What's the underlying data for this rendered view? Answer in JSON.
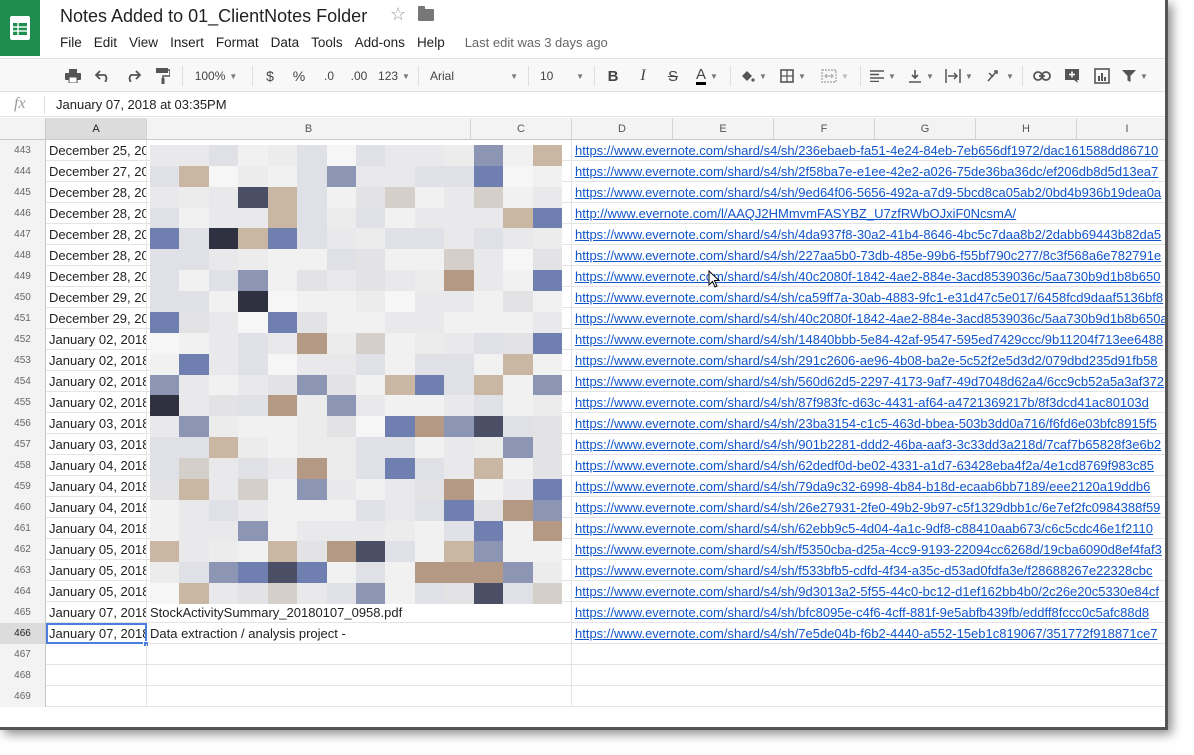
{
  "title": "Notes Added to 01_ClientNotes Folder",
  "menu": [
    "File",
    "Edit",
    "View",
    "Insert",
    "Format",
    "Data",
    "Tools",
    "Add-ons",
    "Help"
  ],
  "last_edit": "Last edit was 3 days ago",
  "toolbar": {
    "zoom": "100%",
    "currency": "$",
    "percent": "%",
    "dec_less": ".0",
    "dec_more": ".00",
    "more_formats": "123",
    "font": "Arial",
    "font_size": "10",
    "bold": "B",
    "italic": "I",
    "strike": "S",
    "text_color": "A"
  },
  "formula_bar": {
    "fx": "fx",
    "value": "January 07, 2018 at 03:35PM"
  },
  "columns": [
    "A",
    "B",
    "C",
    "D",
    "E",
    "F",
    "G",
    "H",
    "I"
  ],
  "rows": [
    {
      "n": "443",
      "a": "December 25, 20",
      "c": "",
      "d": "https://www.evernote.com/shard/s4/sh/236ebaeb-fa51-4e24-84eb-7eb656df1972/dac161588dd86710"
    },
    {
      "n": "444",
      "a": "December 27, 20",
      "c": "",
      "d": "https://www.evernote.com/shard/s4/sh/2f58ba7e-e1ee-42e2-a026-75de36ba36dc/ef206db8d5d13ea7"
    },
    {
      "n": "445",
      "a": "December 28, 20",
      "c": "",
      "d": "https://www.evernote.com/shard/s4/sh/9ed64f06-5656-492a-a7d9-5bcd8ca05ab2/0bd4b936b19dea0a"
    },
    {
      "n": "446",
      "a": "December 28, 20",
      "c": "",
      "d": "http://www.evernote.com/l/AAQJ2HMmvmFASYBZ_U7zfRWbOJxiF0NcsmA/"
    },
    {
      "n": "447",
      "a": "December 28, 20",
      "c": "",
      "d": "https://www.evernote.com/shard/s4/sh/4da937f8-30a2-41b4-8646-4bc5c7daa8b2/2dabb69443b82da5"
    },
    {
      "n": "448",
      "a": "December 28, 20",
      "c": "",
      "d": "https://www.evernote.com/shard/s4/sh/227aa5b0-73db-485e-99b6-f55bf790c277/8c3f568a6e782791e"
    },
    {
      "n": "449",
      "a": "December 28, 20",
      "c": "",
      "d": "https://www.evernote.com/shard/s4/sh/40c2080f-1842-4ae2-884e-3acd8539036c/5aa730b9d1b8b650"
    },
    {
      "n": "450",
      "a": "December 29, 20",
      "c": "",
      "d": "https://www.evernote.com/shard/s4/sh/ca59ff7a-30ab-4883-9fc1-e31d47c5e017/6458fcd9daaf5136bf8"
    },
    {
      "n": "451",
      "a": "December 29, 20",
      "c": "",
      "d": "https://www.evernote.com/shard/s4/sh/40c2080f-1842-4ae2-884e-3acd8539036c/5aa730b9d1b8b650a"
    },
    {
      "n": "452",
      "a": "January 02, 2018",
      "c": "",
      "d": "https://www.evernote.com/shard/s4/sh/14840bbb-5e84-42af-9547-595ed7429ccc/9b11204f713ee6488"
    },
    {
      "n": "453",
      "a": "January 02, 2018",
      "c": "",
      "d": "https://www.evernote.com/shard/s4/sh/291c2606-ae96-4b08-ba2e-5c52f2e5d3d2/079dbd235d91fb58"
    },
    {
      "n": "454",
      "a": "January 02, 2018",
      "c": "",
      "d": "https://www.evernote.com/shard/s4/sh/560d62d5-2297-4173-9af7-49d7048d62a4/6cc9cb52a5a3af372"
    },
    {
      "n": "455",
      "a": "January 02, 2018",
      "c": "",
      "d": "https://www.evernote.com/shard/s4/sh/87f983fc-d63c-4431-af64-a4721369217b/8f3dcd41ac80103d"
    },
    {
      "n": "456",
      "a": "January 03, 2018",
      "c": "",
      "d": "https://www.evernote.com/shard/s4/sh/23ba3154-c1c5-463d-bbea-503b3dd0a716/f6fd6e03bfc8915f5"
    },
    {
      "n": "457",
      "a": "January 03, 2018",
      "c": "",
      "d": "https://www.evernote.com/shard/s4/sh/901b2281-ddd2-46ba-aaf3-3c33dd3a218d/7caf7b65828f3e6b2"
    },
    {
      "n": "458",
      "a": "January 04, 2018",
      "c": "",
      "d": "https://www.evernote.com/shard/s4/sh/62dedf0d-be02-4331-a1d7-63428eba4f2a/4e1cd8769f983c85"
    },
    {
      "n": "459",
      "a": "January 04, 2018",
      "c": "",
      "d": "https://www.evernote.com/shard/s4/sh/79da9c32-6998-4b84-b18d-ecaab6bb7189/eee2120a19ddb6"
    },
    {
      "n": "460",
      "a": "January 04, 2018",
      "c": "",
      "d": "https://www.evernote.com/shard/s4/sh/26e27931-2fe0-49b2-9b97-c5f1329dbb1c/6e7ef2fc0984388f59"
    },
    {
      "n": "461",
      "a": "January 04, 2018",
      "c": "",
      "d": "https://www.evernote.com/shard/s4/sh/62ebb9c5-4d04-4a1c-9df8-c88410aab673/c6c5cdc46e1f2110"
    },
    {
      "n": "462",
      "a": "January 05, 2018",
      "c": "",
      "d": "https://www.evernote.com/shard/s4/sh/f5350cba-d25a-4cc9-9193-22094cc6268d/19cba6090d8ef4faf3"
    },
    {
      "n": "463",
      "a": "January 05, 2018",
      "c": "",
      "d": "https://www.evernote.com/shard/s4/sh/f533bfb5-cdfd-4f34-a35c-d53ad0fdfa3e/f28688267e22328cbc"
    },
    {
      "n": "464",
      "a": "January 05, 2018",
      "c": "",
      "d": "https://www.evernote.com/shard/s4/sh/9d3013a2-5f55-44c0-bc12-d1ef162bb4b0/2c26e20c5330e84cf"
    },
    {
      "n": "465",
      "a": "January 07, 2018",
      "b": "StockActivitySummary_20180107_0958.pdf",
      "d": "https://www.evernote.com/shard/s4/sh/bfc8095e-c4f6-4cff-881f-9e5abfb439fb/eddff8fccc0c5afc88d8"
    },
    {
      "n": "466",
      "a": "January 07, 2018",
      "b": "Data extraction / analysis project -",
      "d": "https://www.evernote.com/shard/s4/sh/7e5de04b-f6b2-4440-a552-15eb1c819067/351772f918871ce7"
    },
    {
      "n": "467",
      "a": "",
      "d": ""
    },
    {
      "n": "468",
      "a": "",
      "d": ""
    },
    {
      "n": "469",
      "a": "",
      "d": ""
    }
  ],
  "colors": {
    "link": "#1155cc",
    "sheets_green": "#1e8e4f",
    "selection": "#4a7fe0"
  },
  "icons": [
    "sheets-logo-icon",
    "star-icon",
    "folder-icon",
    "print-icon",
    "undo-icon",
    "redo-icon",
    "paint-format-icon",
    "fill-color-icon",
    "borders-icon",
    "merge-icon",
    "align-left-icon",
    "valign-bottom-icon",
    "text-wrap-icon",
    "text-rotate-icon",
    "link-icon",
    "comment-icon",
    "chart-icon",
    "filter-icon",
    "mouse-cursor-icon"
  ]
}
